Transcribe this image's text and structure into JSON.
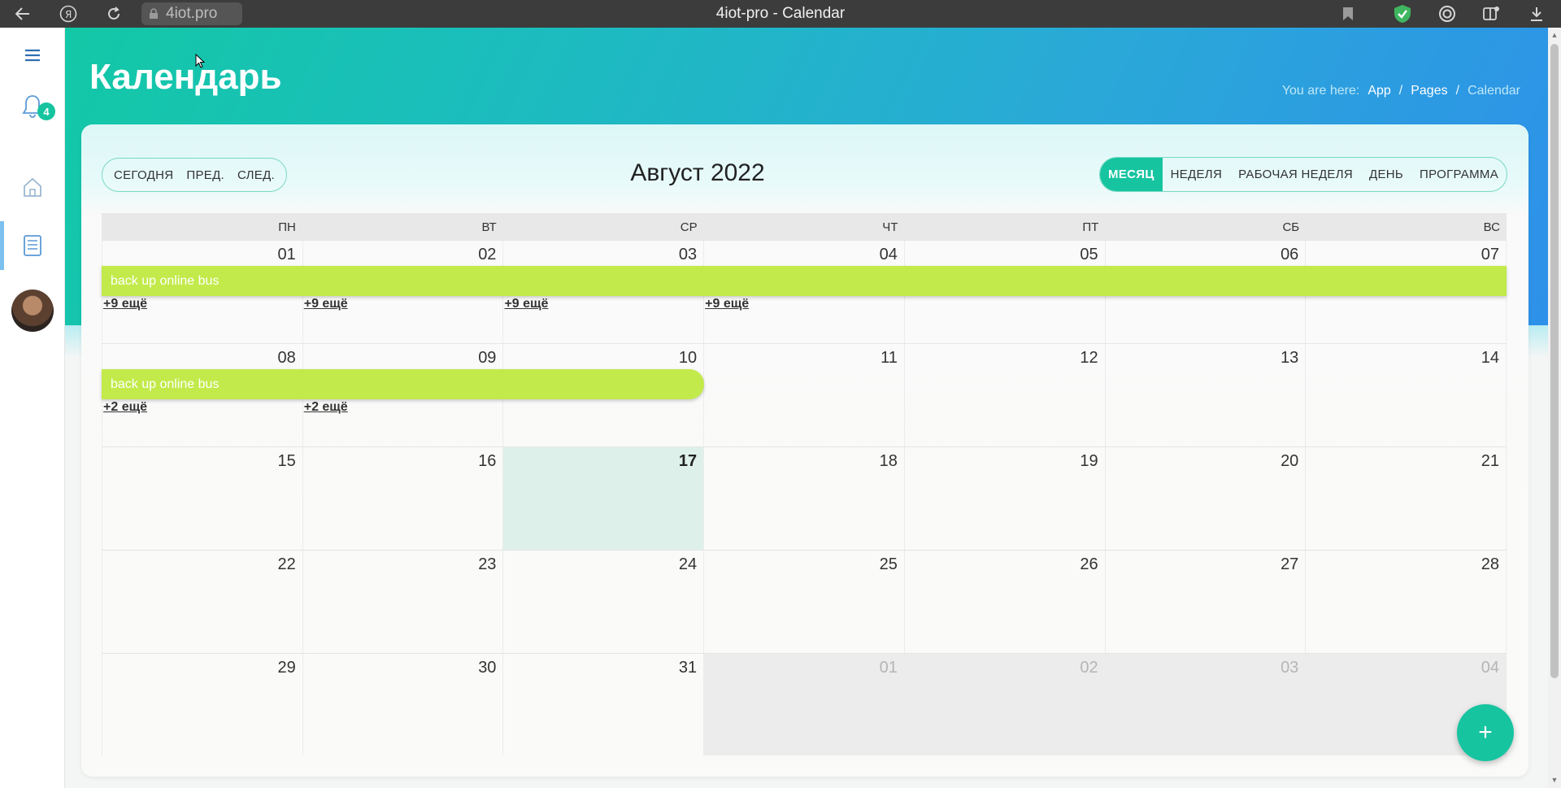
{
  "browser": {
    "url": "4iot.pro",
    "tab_title": "4iot-pro - Calendar"
  },
  "sidebar": {
    "notification_count": "4"
  },
  "header": {
    "title": "Календарь",
    "breadcrumb": {
      "prefix": "You are here:",
      "items": [
        "App",
        "Pages",
        "Calendar"
      ],
      "separator": "/"
    }
  },
  "toolbar": {
    "today": "СЕГОДНЯ",
    "prev": "ПРЕД.",
    "next": "СЛЕД.",
    "month_title": "Август 2022",
    "views": [
      "МЕСЯЦ",
      "НЕДЕЛЯ",
      "РАБОЧАЯ НЕДЕЛЯ",
      "ДЕНЬ",
      "ПРОГРАММА"
    ],
    "active_view": "МЕСЯЦ"
  },
  "calendar": {
    "weekdays": [
      "ПН",
      "ВТ",
      "СР",
      "ЧТ",
      "ПТ",
      "СБ",
      "ВС"
    ],
    "weeks": [
      {
        "days": [
          "01",
          "02",
          "03",
          "04",
          "05",
          "06",
          "07"
        ],
        "event": {
          "title": "back up online bus",
          "start_col": 0,
          "span": 7
        },
        "more": [
          "+9 ещё",
          "+9 ещё",
          "+9 ещё",
          "+9 ещё",
          "",
          "",
          ""
        ]
      },
      {
        "days": [
          "08",
          "09",
          "10",
          "11",
          "12",
          "13",
          "14"
        ],
        "event": {
          "title": "back up online bus",
          "start_col": 0,
          "span": 3
        },
        "more": [
          "+2 ещё",
          "+2 ещё",
          "",
          "",
          "",
          "",
          ""
        ]
      },
      {
        "days": [
          "15",
          "16",
          "17",
          "18",
          "19",
          "20",
          "21"
        ],
        "today_col": 2
      },
      {
        "days": [
          "22",
          "23",
          "24",
          "25",
          "26",
          "27",
          "28"
        ]
      },
      {
        "days": [
          "29",
          "30",
          "31",
          "01",
          "02",
          "03",
          "04"
        ],
        "other_from": 3
      }
    ]
  },
  "fab": {
    "label": "+"
  },
  "colors": {
    "accent": "#16c4a0",
    "event": "#c2ea4a",
    "today": "#ddf1ea"
  }
}
